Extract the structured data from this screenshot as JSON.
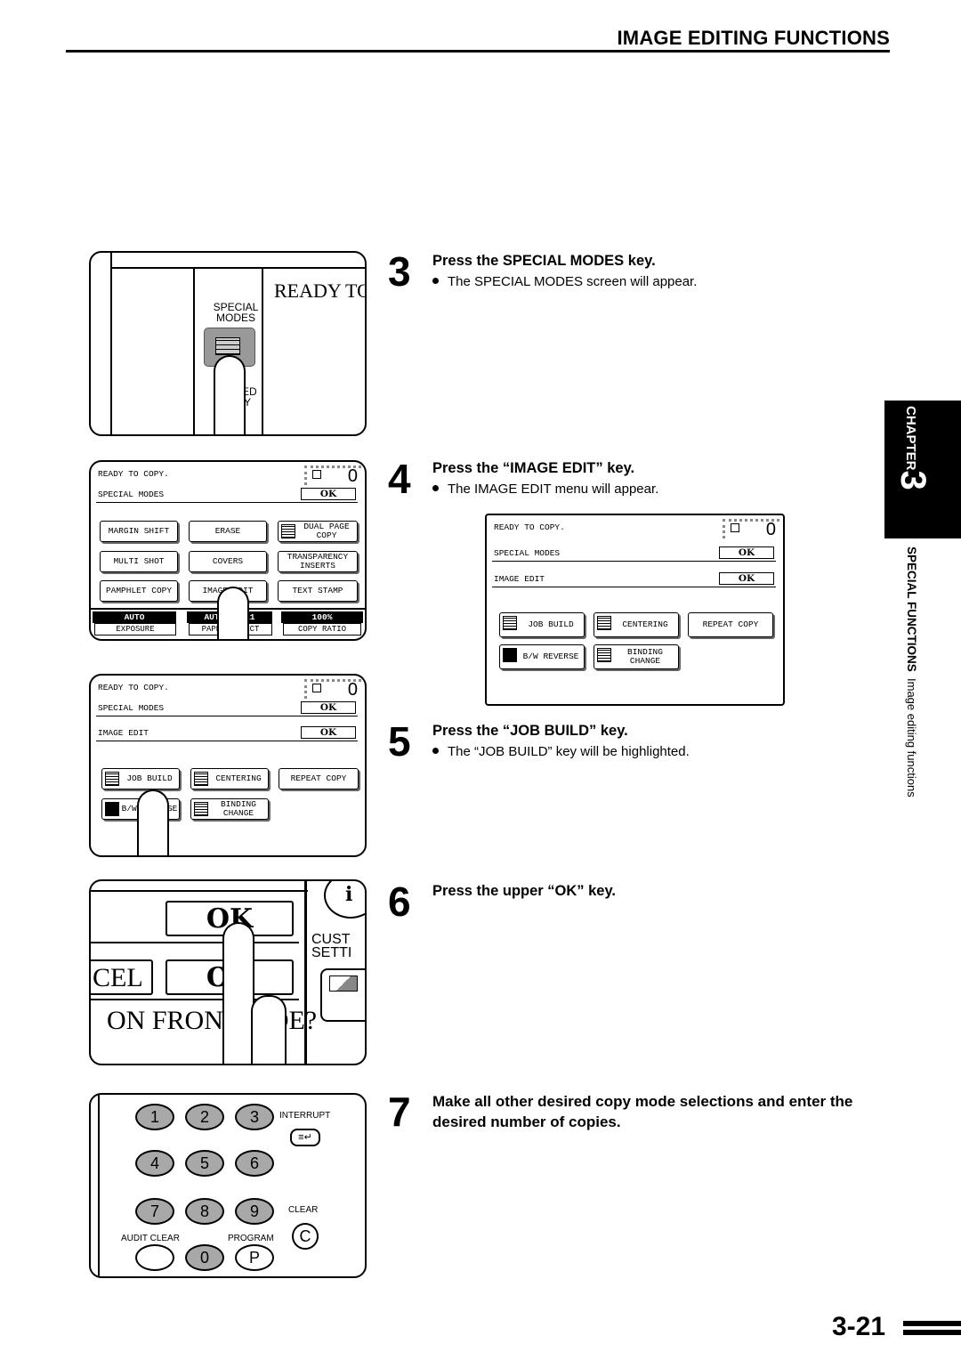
{
  "header": {
    "title": "IMAGE EDITING FUNCTIONS"
  },
  "steps": [
    {
      "number": "3",
      "title": "Press the SPECIAL MODES key.",
      "note": "The SPECIAL MODES screen will appear."
    },
    {
      "number": "4",
      "title": "Press the “IMAGE EDIT” key.",
      "note": "The  IMAGE EDIT menu will appear."
    },
    {
      "number": "5",
      "title": "Press the “JOB BUILD” key.",
      "note": "The  “JOB BUILD” key will be highlighted."
    },
    {
      "number": "6",
      "title": "Press the upper “OK” key."
    },
    {
      "number": "7",
      "title": "Make all other desired copy mode selections and enter the desired number of copies."
    }
  ],
  "side": {
    "chapter_label": "CHAPTER",
    "chapter_number": "3",
    "section": "SPECIAL FUNCTIONS",
    "subsection": "Image editing functions"
  },
  "page_number": "3-21",
  "panel1": {
    "ready_text": "READY TO C",
    "special_modes_label_1": "SPECIAL",
    "special_modes_label_2": "MODES",
    "two_sided_label_1": "2-SIDED",
    "two_sided_label_2": "COPY"
  },
  "screen_special_modes": {
    "status": "READY TO COPY.",
    "counter": "0",
    "title": "SPECIAL MODES",
    "ok": "OK",
    "keys": [
      {
        "label": "MARGIN SHIFT"
      },
      {
        "label": "ERASE"
      },
      {
        "label": "DUAL PAGE COPY"
      },
      {
        "label": "MULTI SHOT"
      },
      {
        "label": "COVERS"
      },
      {
        "label": "TRANSPARENCY INSERTS"
      },
      {
        "label": "PAMPHLET COPY"
      },
      {
        "label": "IMAGE EDIT"
      },
      {
        "label": "TEXT STAMP"
      }
    ],
    "bottom": [
      {
        "value": "AUTO",
        "label": "EXPOSURE"
      },
      {
        "value": "AUTO 8½x11",
        "label": "PAPER SELECT"
      },
      {
        "value": "100%",
        "label": "COPY RATIO"
      }
    ]
  },
  "screen_image_edit": {
    "status": "READY TO COPY.",
    "counter": "0",
    "title1": "SPECIAL MODES",
    "title2": "IMAGE EDIT",
    "ok": "OK",
    "keys": [
      {
        "label": "JOB BUILD"
      },
      {
        "label": "CENTERING"
      },
      {
        "label": "REPEAT COPY"
      },
      {
        "label": "B/W REVERSE"
      },
      {
        "label": "BINDING CHANGE"
      }
    ]
  },
  "panel4": {
    "ok_upper": "OK",
    "ok_lower": "OK",
    "cancel_partial": "CEL",
    "question_partial": "ON FRONT SIDE?",
    "custom_label_1": "CUST",
    "custom_label_2": "SETTI",
    "info_glyph": "i"
  },
  "keypad": {
    "keys": [
      "1",
      "2",
      "3",
      "4",
      "5",
      "6",
      "7",
      "8",
      "9",
      "0"
    ],
    "interrupt_label": "INTERRUPT",
    "interrupt_glyph": "≡↵",
    "clear_label": "CLEAR",
    "clear_glyph": "C",
    "audit_clear_label": "AUDIT CLEAR",
    "program_label": "PROGRAM",
    "program_glyph": "P"
  }
}
